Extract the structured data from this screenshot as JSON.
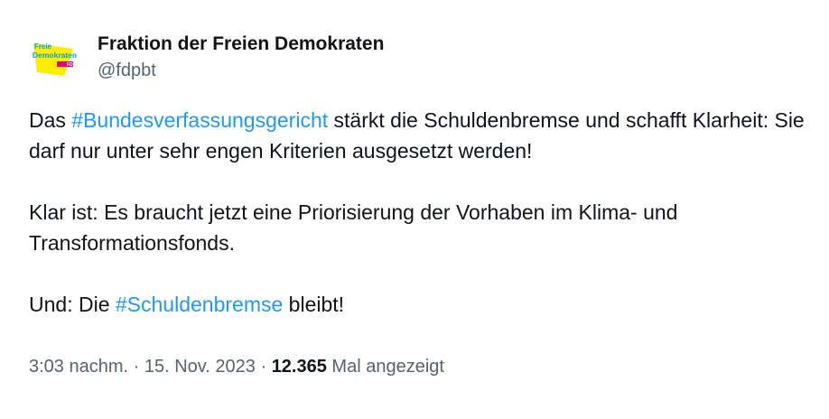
{
  "author": {
    "display_name": "Fraktion der Freien Demokraten",
    "handle": "@fdpbt",
    "logo_text_line1": "Freie",
    "logo_text_line2": "Demokraten",
    "logo_text_line3": "FDP"
  },
  "tweet": {
    "p1_pre": "Das ",
    "p1_hashtag": "#Bundesverfassungsgericht",
    "p1_post": " stärkt die Schuldenbremse und schafft Klarheit: Sie darf nur unter sehr engen Kriterien ausgesetzt werden!",
    "p2": "Klar ist: Es braucht jetzt eine Priorisierung der Vorhaben im Klima- und Transformationsfonds.",
    "p3_pre": "Und: Die ",
    "p3_hashtag": "#Schuldenbremse",
    "p3_post": " bleibt!"
  },
  "meta": {
    "time": "3:03 nachm.",
    "sep1": " · ",
    "date": "15. Nov. 2023",
    "sep2": " · ",
    "views_count": "12.365",
    "views_label": " Mal angezeigt"
  },
  "colors": {
    "hashtag": "#1d9bf0",
    "secondary_text": "#536471",
    "fdp_yellow": "#ffed00",
    "fdp_blue": "#009ee3",
    "fdp_magenta": "#e5007d"
  }
}
